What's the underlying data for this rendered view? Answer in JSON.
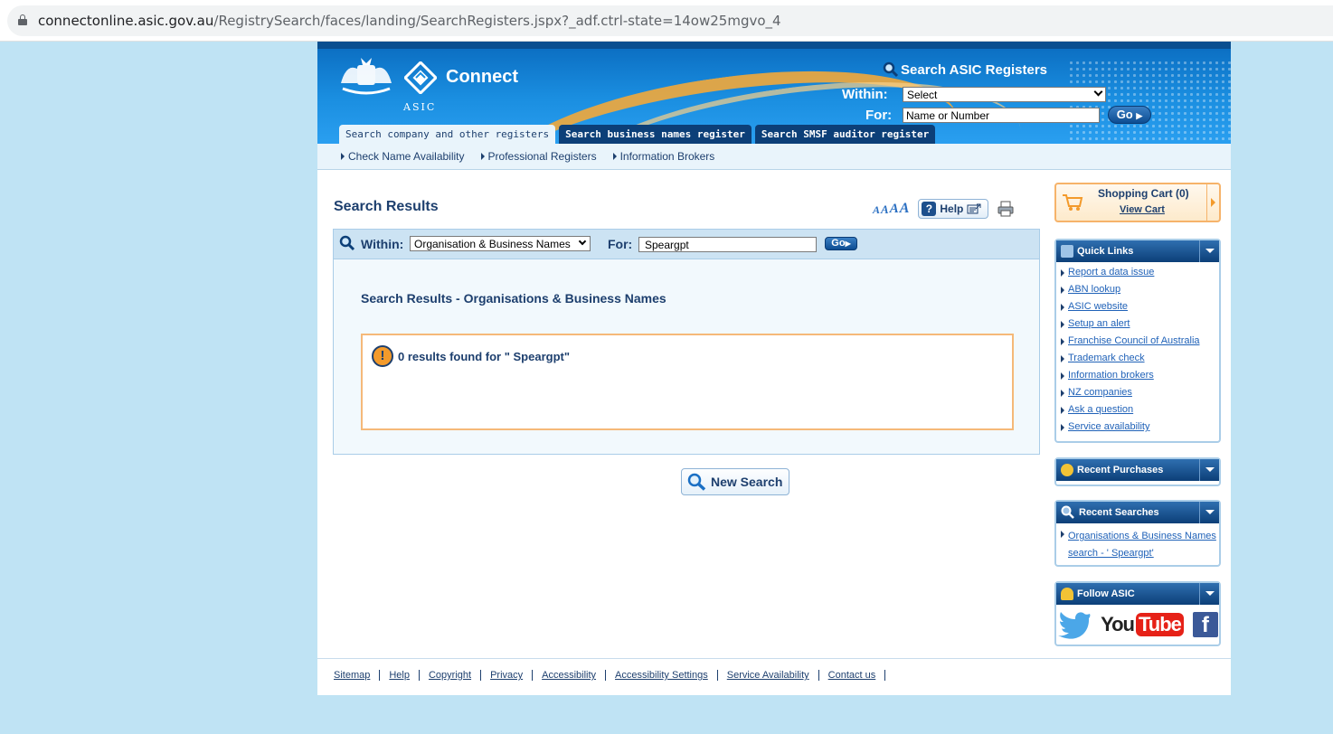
{
  "browser": {
    "url_host": "connectonline.asic.gov.au",
    "url_path": "/RegistrySearch/faces/landing/SearchRegisters.jspx?_adf.ctrl-state=14ow25mgvo_4"
  },
  "header": {
    "agency": "ASIC",
    "product": "Connect",
    "search_title": "Search ASIC Registers",
    "within_label": "Within:",
    "within_value": "Select",
    "for_label": "For:",
    "for_placeholder": "Name or Number",
    "go_label": "Go"
  },
  "tabs": [
    {
      "label": "Search company and other registers",
      "active": true
    },
    {
      "label": "Search business names register",
      "active": false
    },
    {
      "label": "Search SMSF auditor register",
      "active": false
    }
  ],
  "subnav": [
    "Check Name Availability",
    "Professional Registers",
    "Information Brokers"
  ],
  "main": {
    "title": "Search Results",
    "help_label": "Help",
    "search_bar": {
      "within_label": "Within:",
      "within_value": "Organisation & Business Names",
      "for_label": "For:",
      "for_value": "Speargpt",
      "go_label": "Go"
    },
    "results_title": "Search Results - Organisations & Business Names",
    "message": "0 results found for \" Speargpt\"",
    "new_search_label": "New Search"
  },
  "footer": [
    "Sitemap",
    "Help",
    "Copyright",
    "Privacy",
    "Accessibility",
    "Accessibility Settings",
    "Service Availability",
    "Contact us"
  ],
  "sidebar": {
    "cart_title": "Shopping Cart (0)",
    "cart_link": "View Cart",
    "quick_links_title": "Quick Links",
    "quick_links": [
      "Report a data issue",
      "ABN lookup",
      "ASIC website",
      "Setup an alert",
      "Franchise Council of Australia",
      "Trademark check",
      "Information brokers",
      "NZ companies",
      "Ask a question",
      "Service availability"
    ],
    "recent_purchases_title": "Recent Purchases",
    "recent_searches_title": "Recent Searches",
    "recent_searches": [
      "Organisations & Business Names search - ' Speargpt'"
    ],
    "follow_title": "Follow ASIC",
    "youtube_you": "You",
    "youtube_tube": "Tube",
    "facebook_glyph": "f"
  },
  "colors": {
    "brand_blue": "#0a6bbf",
    "navy": "#0c3f78",
    "accent_orange": "#f39a2b",
    "page_bg": "#bfe3f4"
  }
}
